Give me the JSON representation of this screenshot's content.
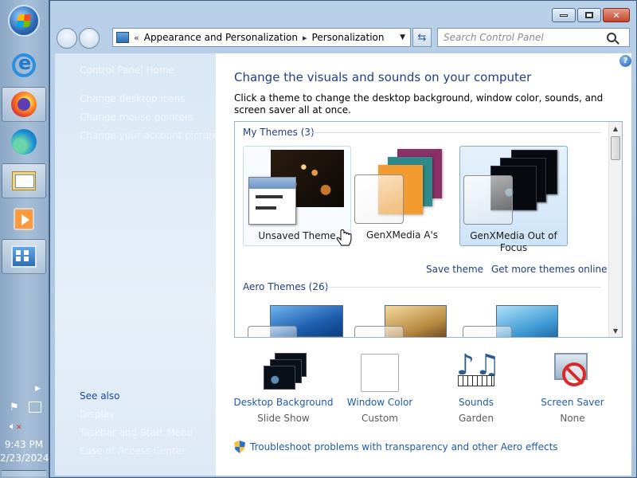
{
  "taskbar": {
    "clock_time": "9:43 PM",
    "clock_date": "2/23/2024",
    "pinned": [
      "start-orb",
      "internet-explorer",
      "firefox",
      "edge",
      "windows-explorer",
      "media-player",
      "control-panel"
    ]
  },
  "window": {
    "controls": {
      "minimize": "minimize",
      "maximize": "maximize",
      "close": "✕"
    }
  },
  "address_bar": {
    "crumb_sep": "«",
    "crumbs": [
      "Appearance and Personalization",
      "Personalization"
    ],
    "crumb_arrow": "▸"
  },
  "search": {
    "placeholder": "Search Control Panel"
  },
  "left_pane": {
    "links": [
      "Control Panel Home",
      "Change desktop icons",
      "Change mouse pointers",
      "Change your account picture"
    ],
    "see_also_title": "See also",
    "see_also": [
      "Display",
      "Taskbar and Start Menu",
      "Ease of Access Center"
    ]
  },
  "main": {
    "heading": "Change the visuals and sounds on your computer",
    "subtext": "Click a theme to change the desktop background, window color, sounds, and screen saver all at once.",
    "my_themes_label": "My Themes (3)",
    "aero_themes_label": "Aero Themes (26)",
    "themes": [
      {
        "name": "Unsaved Theme"
      },
      {
        "name": "GenXMedia A's"
      },
      {
        "name": "GenXMedia Out of Focus"
      }
    ],
    "save_theme": "Save theme",
    "get_more": "Get more themes online",
    "bottom": [
      {
        "label": "Desktop Background",
        "sub": "Slide Show",
        "icon": "desktop-background-icon"
      },
      {
        "label": "Window Color",
        "sub": "Custom",
        "icon": "window-color-icon"
      },
      {
        "label": "Sounds",
        "sub": "Garden",
        "icon": "sounds-icon"
      },
      {
        "label": "Screen Saver",
        "sub": "None",
        "icon": "screen-saver-icon"
      }
    ],
    "troubleshoot": "Troubleshoot problems with transparency and other Aero effects"
  },
  "colors": {
    "heading": "#1f3e83",
    "link": "#1f5ba8",
    "selection": "#cfe4f8"
  }
}
